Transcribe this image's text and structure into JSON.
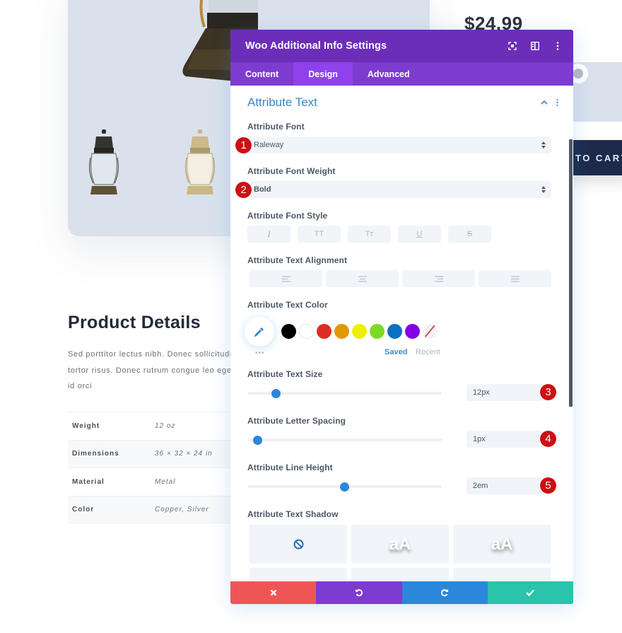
{
  "background_page": {
    "product_price": "$24.99",
    "add_to_cart_label": "TO CART",
    "product_details_title": "Product Details",
    "product_description_lines": [
      "Sed porttitor lectus nibh. Donec sollicitudin",
      "tortor risus. Donec rutrum congue leo eget",
      "id orci"
    ],
    "attributes": [
      {
        "label": "Weight",
        "value": "12 oz"
      },
      {
        "label": "Dimensions",
        "value": "36 × 32 × 24 in"
      },
      {
        "label": "Material",
        "value": "Metal"
      },
      {
        "label": "Color",
        "value": "Copper, Silver"
      }
    ]
  },
  "modal": {
    "title": "Woo Additional Info Settings",
    "header_icons": [
      "focus-icon",
      "split-view-icon",
      "more-vertical-icon"
    ],
    "tabs": [
      {
        "label": "Content",
        "active": false
      },
      {
        "label": "Design",
        "active": true
      },
      {
        "label": "Advanced",
        "active": false
      }
    ],
    "section": {
      "title": "Attribute Text",
      "expanded": true
    },
    "fields": {
      "font": {
        "label": "Attribute Font",
        "value": "Raleway",
        "step": "1"
      },
      "font_weight": {
        "label": "Attribute Font Weight",
        "value": "Bold",
        "step": "2"
      },
      "font_style": {
        "label": "Attribute Font Style",
        "options": [
          {
            "name": "italic",
            "glyph": "I"
          },
          {
            "name": "uppercase",
            "glyph": "TT"
          },
          {
            "name": "capitalize",
            "glyph": "Tт"
          },
          {
            "name": "underline",
            "glyph": "U"
          },
          {
            "name": "strikethrough",
            "glyph": "S"
          }
        ]
      },
      "text_alignment": {
        "label": "Attribute Text Alignment",
        "options": [
          "left",
          "center",
          "right",
          "justify"
        ]
      },
      "text_color": {
        "label": "Attribute Text Color",
        "swatches": [
          "#000000",
          "#ffffff",
          "#e02b20",
          "#e09900",
          "#edf000",
          "#7cda24",
          "#0c71c3",
          "#8300e9",
          "none"
        ],
        "more_label": "•••",
        "saved_label": "Saved",
        "recent_label": "Recent"
      },
      "text_size": {
        "label": "Attribute Text Size",
        "value": "12px",
        "slider_fraction": 0.13,
        "step": "3"
      },
      "letter_spacing": {
        "label": "Attribute Letter Spacing",
        "value": "1px",
        "slider_fraction": 0.03,
        "step": "4"
      },
      "line_height": {
        "label": "Attribute Line Height",
        "value": "2em",
        "slider_fraction": 0.5,
        "step": "5"
      },
      "text_shadow": {
        "label": "Attribute Text Shadow",
        "options": [
          "none",
          "aA",
          "aA"
        ],
        "sample_text": "aA"
      }
    },
    "footer": {
      "buttons": [
        {
          "name": "cancel",
          "color": "#ef5555"
        },
        {
          "name": "undo",
          "color": "#7e3bd0"
        },
        {
          "name": "redo",
          "color": "#2b87da"
        },
        {
          "name": "save",
          "color": "#29c4a9"
        }
      ]
    },
    "colors": {
      "header": "#6c2eb9",
      "tabs_bar": "#7e3bd0",
      "active_tab": "#8f42ec",
      "accent": "#2b87da",
      "step_badge": "#cd0f14"
    }
  }
}
